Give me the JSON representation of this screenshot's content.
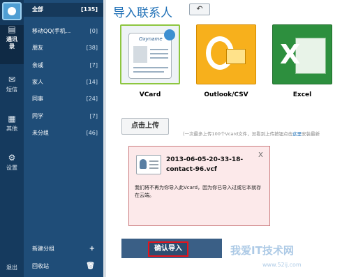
{
  "rail": {
    "items": [
      {
        "icon": "contacts-icon",
        "label": "通讯录"
      },
      {
        "icon": "mail-icon",
        "label": "短信"
      },
      {
        "icon": "grid-icon",
        "label": "其他"
      },
      {
        "icon": "gear-icon",
        "label": "设置"
      }
    ],
    "exit_label": "退出"
  },
  "groups": {
    "items": [
      {
        "label": "全部",
        "count": "[135]"
      },
      {
        "label": "移动QQ(手机...",
        "count": "[0]"
      },
      {
        "label": "朋友",
        "count": "[38]"
      },
      {
        "label": "亲戚",
        "count": "[7]"
      },
      {
        "label": "家人",
        "count": "[14]"
      },
      {
        "label": "同事",
        "count": "[24]"
      },
      {
        "label": "同学",
        "count": "[7]"
      },
      {
        "label": "未分组",
        "count": "[46]"
      }
    ],
    "new_group_label": "新建分组",
    "new_group_action": "+",
    "recycle_label": "回收站"
  },
  "main": {
    "title": "导入联系人",
    "back_symbol": "↶",
    "formats": [
      {
        "label": "VCard",
        "logo_text": "Oxyname"
      },
      {
        "label": "Outlook/CSV"
      },
      {
        "label": "Excel"
      }
    ],
    "upload_label": "点击上传",
    "hint_prefix": "（一次最多上传100个Vcard文件，没看到上传按钮点击",
    "hint_link": "这里",
    "hint_suffix": "安装最新",
    "notice": {
      "filename": "2013-06-05-20-33-18-contact-96.vcf",
      "message": "我们将不再为你导入此Vcard，因为你已导入过或它本就存在云端。",
      "close": "X"
    },
    "confirm_label": "确认导入"
  },
  "watermark": {
    "text": "我爱IT技术网",
    "url": "www.52ij.com"
  }
}
